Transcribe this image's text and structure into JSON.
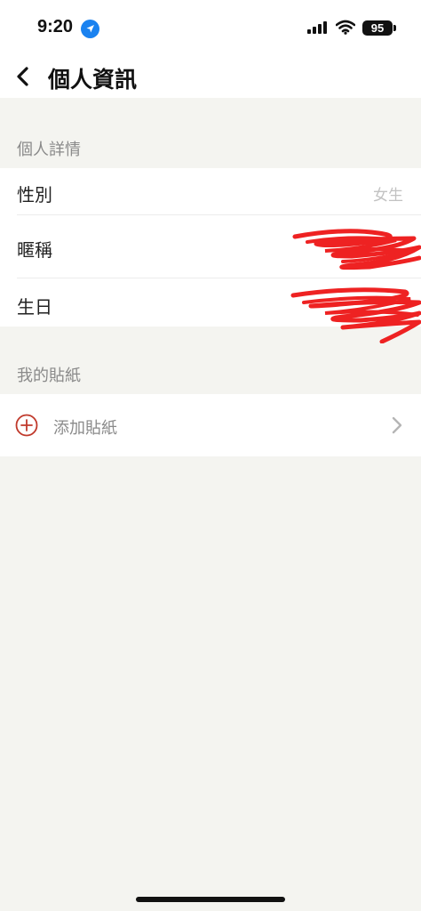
{
  "status_bar": {
    "time": "9:20",
    "battery": "95"
  },
  "nav": {
    "title": "個人資訊"
  },
  "details_section": {
    "header": "個人詳情",
    "rows": [
      {
        "label": "性別",
        "value": "女生"
      },
      {
        "label": "暱稱",
        "value": ""
      },
      {
        "label": "生日",
        "value": ""
      }
    ]
  },
  "stickers_section": {
    "header": "我的貼紙",
    "add_label": "添加貼紙"
  },
  "colors": {
    "background": "#f4f4f0",
    "add_icon": "#c0392b",
    "redaction": "#ee2222"
  }
}
